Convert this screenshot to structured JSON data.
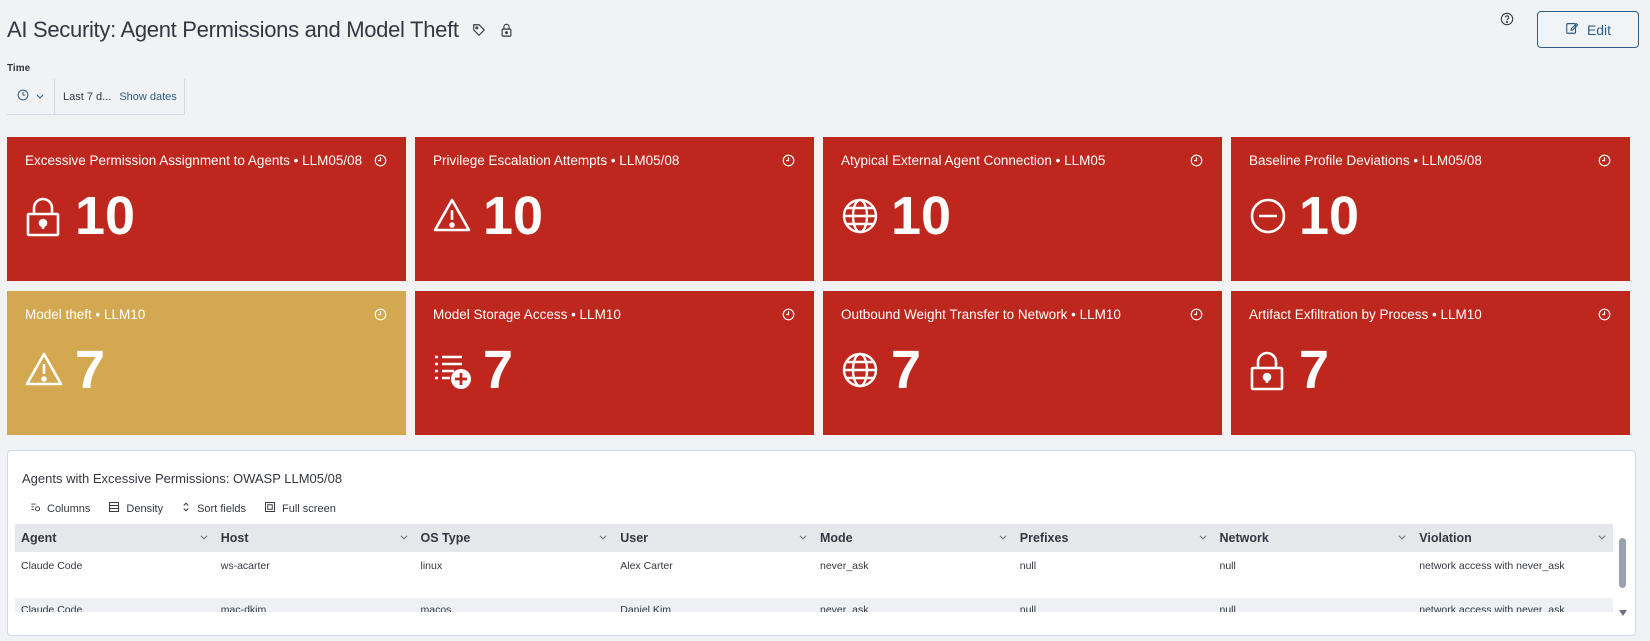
{
  "header": {
    "title": "AI Security: Agent Permissions and Model Theft",
    "edit_label": "Edit"
  },
  "time": {
    "label": "Time",
    "range": "Last 7 d...",
    "show_dates": "Show dates"
  },
  "tiles": [
    {
      "title": "Excessive Permission Assignment to Agents • LLM05/08",
      "value": "10",
      "icon": "lock-icon",
      "color": "#bd271e"
    },
    {
      "title": "Privilege Escalation Attempts • LLM05/08",
      "value": "10",
      "icon": "warning-icon",
      "color": "#bd271e"
    },
    {
      "title": "Atypical External Agent Connection • LLM05",
      "value": "10",
      "icon": "globe-icon",
      "color": "#bd271e"
    },
    {
      "title": "Baseline Profile Deviations • LLM05/08",
      "value": "10",
      "icon": "minus-circle-icon",
      "color": "#bd271e"
    },
    {
      "title": "Model theft • LLM10",
      "value": "7",
      "icon": "warning-icon",
      "color": "#d4a851"
    },
    {
      "title": "Model Storage Access • LLM10",
      "value": "7",
      "icon": "list-add-icon",
      "color": "#bd271e"
    },
    {
      "title": "Outbound Weight Transfer to Network • LLM10",
      "value": "7",
      "icon": "globe-icon",
      "color": "#bd271e"
    },
    {
      "title": "Artifact Exfiltration by Process • LLM10",
      "value": "7",
      "icon": "lock-icon",
      "color": "#bd271e"
    }
  ],
  "table": {
    "title": "Agents with Excessive Permissions: OWASP LLM05/08",
    "toolbar": {
      "columns": "Columns",
      "density": "Density",
      "sort": "Sort fields",
      "fullscreen": "Full screen"
    },
    "columns": [
      "Agent",
      "Host",
      "OS Type",
      "User",
      "Mode",
      "Prefixes",
      "Network",
      "Violation"
    ],
    "rows": [
      [
        "Claude Code",
        "ws-acarter",
        "linux",
        "Alex Carter",
        "never_ask",
        "null",
        "null",
        "network access with never_ask"
      ],
      [
        "Claude Code",
        "mac-dkim",
        "macos",
        "Daniel Kim",
        "never_ask",
        "null",
        "null",
        "network access with never_ask"
      ]
    ]
  }
}
